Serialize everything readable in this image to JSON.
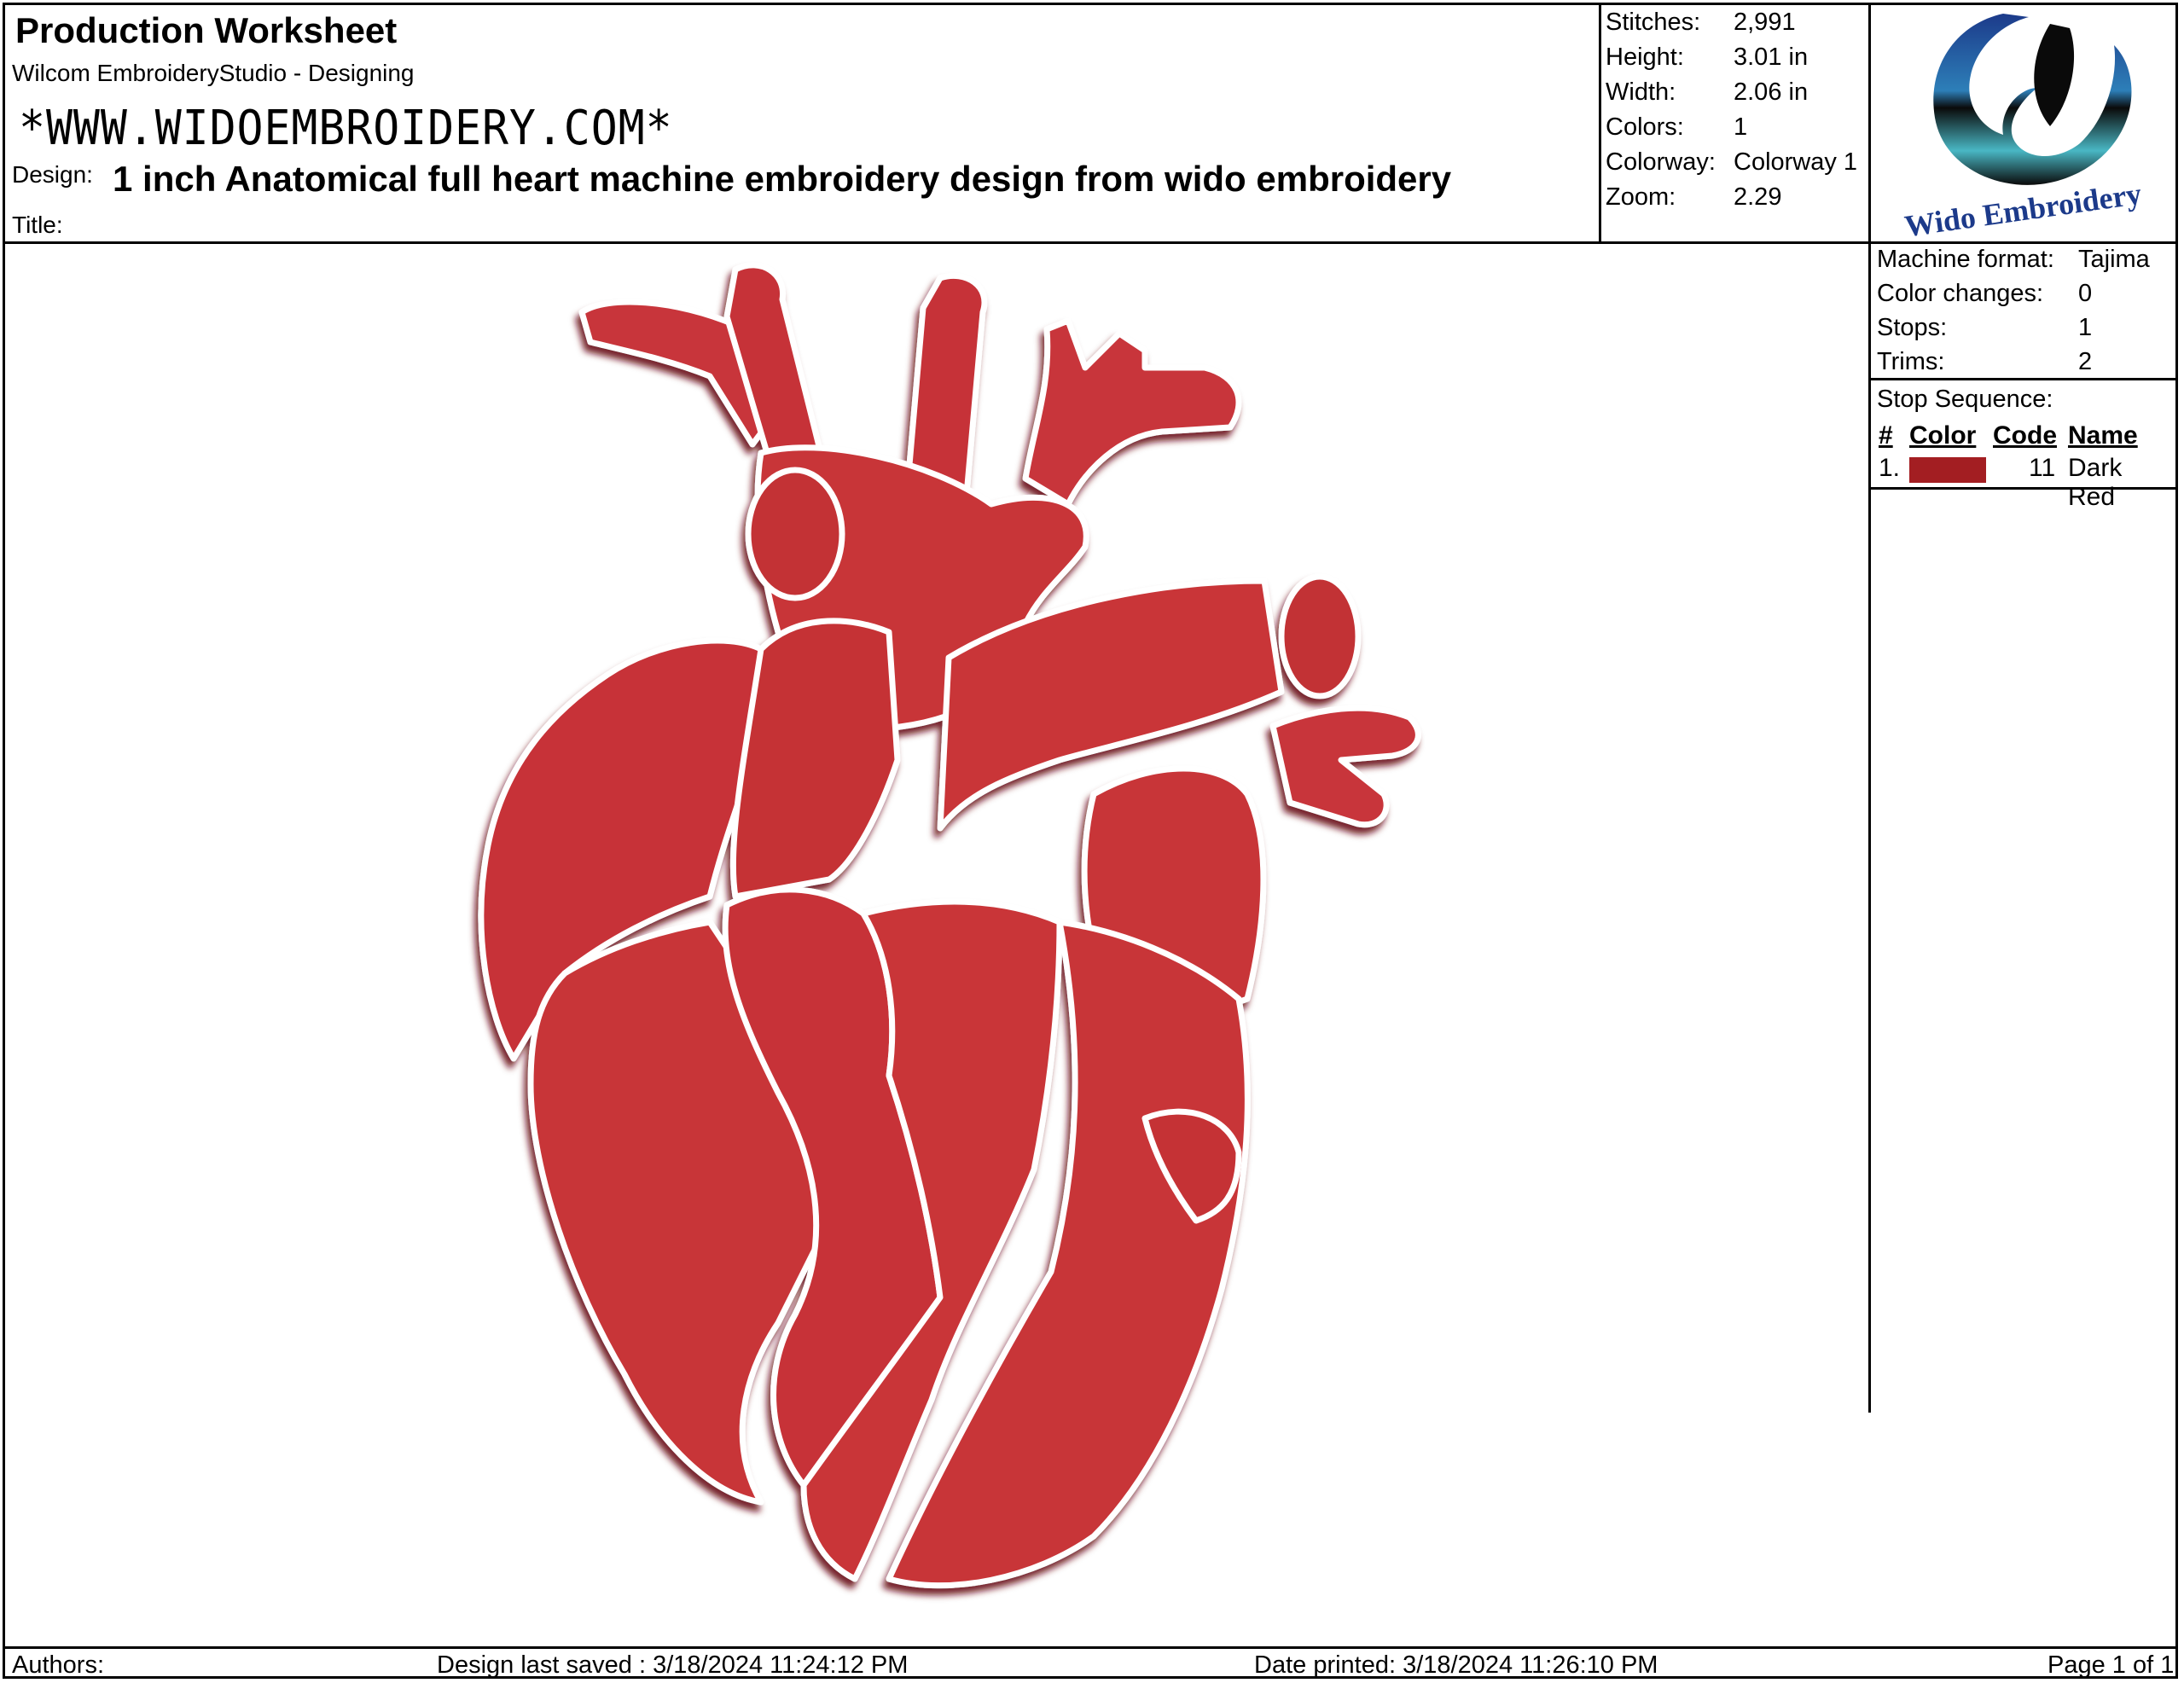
{
  "header": {
    "title": "Production Worksheet",
    "subtitle": "Wilcom EmbroideryStudio - Designing",
    "url_text": "*WWW.WIDOEMBROIDERY.COM*",
    "design_label": "Design:",
    "design_value": "1 inch Anatomical full heart machine embroidery design from wido embroidery",
    "title_label": "Title:"
  },
  "stats": [
    {
      "label": "Stitches:",
      "value": "2,991"
    },
    {
      "label": "Height:",
      "value": "3.01 in"
    },
    {
      "label": "Width:",
      "value": "2.06 in"
    },
    {
      "label": "Colors:",
      "value": "1"
    },
    {
      "label": "Colorway:",
      "value": "Colorway 1"
    },
    {
      "label": "Zoom:",
      "value": "2.29"
    }
  ],
  "logo": {
    "text": "Wido Embroidery",
    "colors": {
      "ring": "#1c3a8a",
      "dark": "#0a0a0a",
      "teal": "#49b7c4"
    }
  },
  "machine": [
    {
      "label": "Machine format:",
      "value": "Tajima"
    },
    {
      "label": "Color changes:",
      "value": "0"
    },
    {
      "label": "Stops:",
      "value": "1"
    },
    {
      "label": "Trims:",
      "value": "2"
    }
  ],
  "stop_sequence": {
    "title": "Stop Sequence:",
    "headers": {
      "num": "#",
      "color": "Color",
      "code": "Code",
      "name": "Name"
    },
    "rows": [
      {
        "num": "1.",
        "color_hex": "#a31e22",
        "code": "11",
        "name": "Dark Red"
      }
    ]
  },
  "footer": {
    "authors": "Authors:",
    "last_saved": "Design last saved : 3/18/2024 11:24:12 PM",
    "printed": "Date printed: 3/18/2024 11:26:10 PM",
    "page": "Page 1 of 1"
  },
  "design_image": {
    "subject": "heart-embroidery",
    "colors": {
      "thread": "#c8353a",
      "light": "#d9484c",
      "shadow": "#7d1518"
    }
  }
}
